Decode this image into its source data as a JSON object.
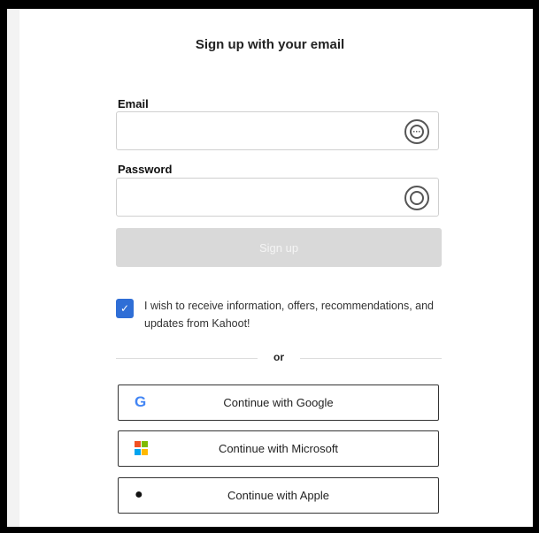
{
  "title": "Sign up with your email",
  "email": {
    "label": "Email",
    "value": "",
    "placeholder": ""
  },
  "password": {
    "label": "Password",
    "value": "",
    "placeholder": ""
  },
  "signup_button": "Sign up",
  "consent": {
    "checked": true,
    "text": "I wish to receive information, offers, recommendations, and updates from Kahoot!"
  },
  "divider_text": "or",
  "providers": [
    {
      "label": "Continue with Google",
      "icon": "google-icon"
    },
    {
      "label": "Continue with Microsoft",
      "icon": "microsoft-icon"
    },
    {
      "label": "Continue with Apple",
      "icon": "apple-icon"
    }
  ],
  "colors": {
    "checkbox": "#2f6ed6",
    "signup_disabled": "#d9d9d9",
    "microsoft": [
      "#f25022",
      "#7fba00",
      "#00a4ef",
      "#ffb900"
    ]
  }
}
